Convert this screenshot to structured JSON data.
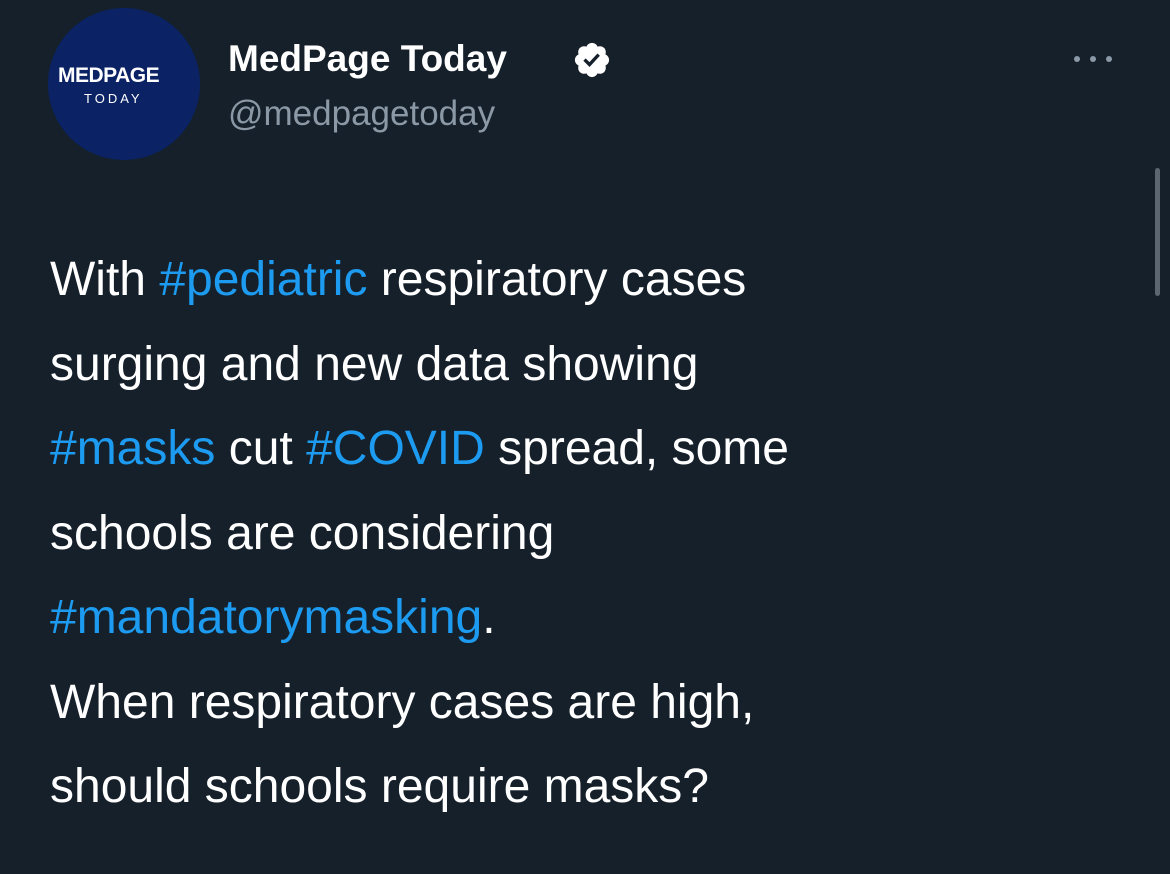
{
  "account": {
    "avatar_text": "MEDPAGE",
    "avatar_subtext": "TODAY",
    "display_name": "MedPage Today",
    "handle": "@medpagetoday",
    "verified_icon": "verified-badge-icon"
  },
  "more_button": {
    "icon": "more-horizontal-icon"
  },
  "tweet": {
    "lines": [
      {
        "parts": [
          {
            "text": "With ",
            "tag": false
          },
          {
            "text": "#pediatric",
            "tag": true
          },
          {
            "text": " respiratory cases",
            "tag": false
          }
        ]
      },
      {
        "parts": [
          {
            "text": "surging and new data showing",
            "tag": false
          }
        ]
      },
      {
        "parts": [
          {
            "text": "#masks",
            "tag": true
          },
          {
            "text": " cut ",
            "tag": false
          },
          {
            "text": "#COVID",
            "tag": true
          },
          {
            "text": " spread, some",
            "tag": false
          }
        ]
      },
      {
        "parts": [
          {
            "text": "schools are considering",
            "tag": false
          }
        ]
      },
      {
        "parts": [
          {
            "text": "#mandatorymasking",
            "tag": true
          },
          {
            "text": ".",
            "tag": false
          }
        ]
      },
      {
        "parts": [
          {
            "text": "When respiratory cases are high,",
            "tag": false
          }
        ]
      },
      {
        "parts": [
          {
            "text": "should schools require masks?",
            "tag": false
          }
        ]
      }
    ]
  },
  "colors": {
    "background": "#15202b",
    "hashtag": "#1d9bf0",
    "secondary_text": "#8b98a5",
    "avatar_bg": "#0b2265"
  }
}
